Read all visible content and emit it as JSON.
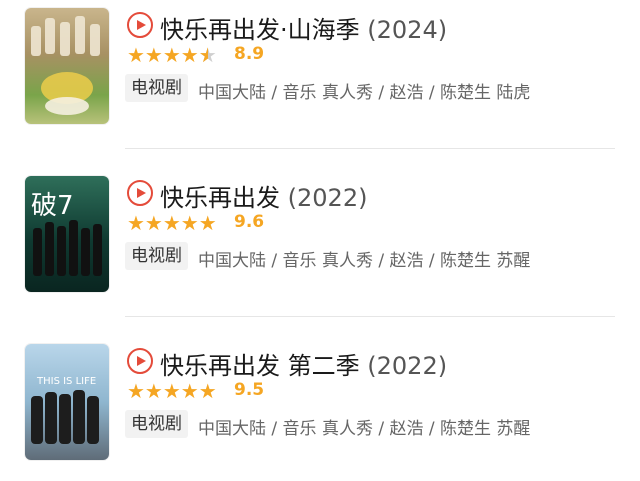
{
  "items": [
    {
      "title": "快乐再出发·山海季",
      "year": "(2024)",
      "score": "8.9",
      "tag": "电视剧",
      "meta": "中国大陆 / 音乐 真人秀 / 赵浩 / 陈楚生 陆虎",
      "rating": 4.5
    },
    {
      "title": "快乐再出发",
      "year": "(2022)",
      "score": "9.6",
      "tag": "电视剧",
      "meta": "中国大陆 / 音乐 真人秀 / 赵浩 / 陈楚生 苏醒",
      "rating": 5
    },
    {
      "title": "快乐再出发 第二季",
      "year": "(2022)",
      "score": "9.5",
      "tag": "电视剧",
      "meta": "中国大陆 / 音乐 真人秀 / 赵浩 / 陈楚生 苏醒",
      "rating": 5
    }
  ],
  "colors": {
    "accent": "#e44b3a",
    "star": "#f5a623"
  }
}
